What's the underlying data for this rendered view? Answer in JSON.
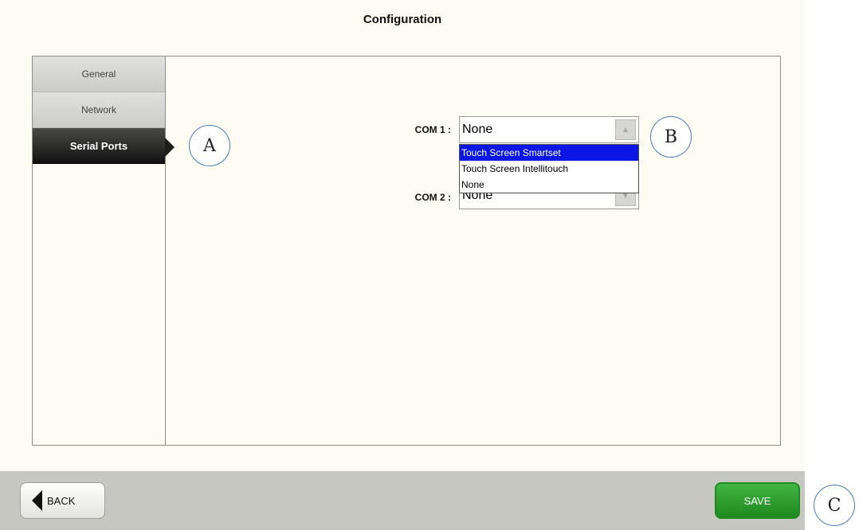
{
  "header": {
    "title": "Configuration"
  },
  "sidebar": {
    "items": [
      {
        "label": "General"
      },
      {
        "label": "Network"
      },
      {
        "label": "Serial Ports"
      }
    ]
  },
  "serial": {
    "com1": {
      "label": "COM 1 :",
      "value": "None"
    },
    "com2": {
      "label": "COM 2 :",
      "value": "None"
    },
    "dropdown_options": [
      "Touch Screen Smartset",
      "Touch Screen Intellitouch",
      "None"
    ],
    "highlighted_option": "Touch Screen Smartset"
  },
  "callouts": {
    "a": "A",
    "b": "B",
    "c": "C"
  },
  "footer": {
    "back_label": "BACK",
    "save_label": "SAVE"
  },
  "colors": {
    "save_green": "#1e881e",
    "active_tab": "#1c1c1b",
    "dropdown_highlight": "#0a16e6",
    "callout_border": "#4b7db3"
  }
}
